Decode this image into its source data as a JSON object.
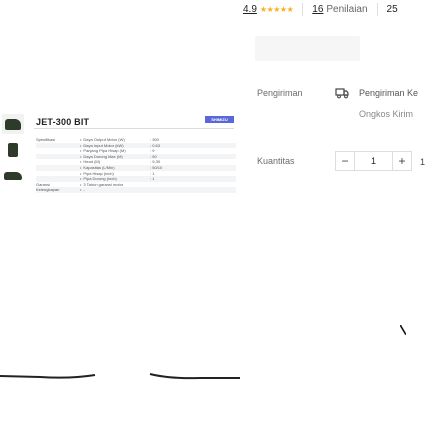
{
  "product": {
    "model_title": "JET-300 BIT",
    "brand_tag": "SHIMIZU",
    "specs": [
      {
        "category": "Spesifikasi",
        "name": "Daya Output Motor (W)",
        "value": ": 300"
      },
      {
        "category": "",
        "name": "Daya Input Motor (kW)",
        "value": ": 0.63"
      },
      {
        "category": "",
        "name": "Panjang Pipa Hisap (M)",
        "value": ": 9"
      },
      {
        "category": "",
        "name": "Daya Dorong Max (M)",
        "value": ": 50"
      },
      {
        "category": "",
        "name": "Head (M)",
        "value": ": 9-30"
      },
      {
        "category": "",
        "name": "Kapasitas (L/Min)",
        "value": ": 50/10"
      },
      {
        "category": "",
        "name": "Pipa Hisap (inch)",
        "value": ": 1"
      },
      {
        "category": "",
        "name": "Pipa Dorong (inch)",
        "value": ": 1"
      },
      {
        "category": "Garansi",
        "name": "3 Tahun garansi motor",
        "value": ""
      },
      {
        "category": "Kelengkapan",
        "name": "-",
        "value": ""
      }
    ]
  },
  "purchase": {
    "rating": "4.9",
    "stars": "★★★★★",
    "review_count": "16",
    "review_label": "Penilaian",
    "sold_count": "25",
    "shipping_label": "Pengiriman",
    "shipping_text": "Pengiriman Ke",
    "shipping_sub": "Ongkos Kirim",
    "quantity_label": "Kuantitas",
    "quantity_value": "1",
    "minus": "−",
    "plus": "+",
    "stock_hint": "1"
  },
  "colors": {
    "accent_star": "#f6b01e",
    "brand_tag": "#5a67d8"
  }
}
